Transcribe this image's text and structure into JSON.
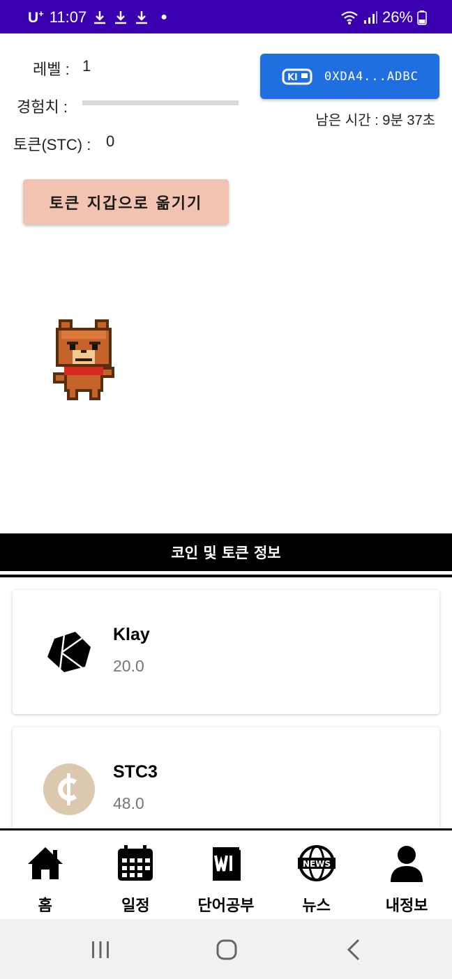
{
  "status_bar": {
    "carrier": "U",
    "carrier_sup": "+",
    "time": "11:07",
    "battery": "26%",
    "icons": [
      "download-icon",
      "download-icon",
      "download-icon",
      "dot-icon",
      "wifi-icon",
      "signal-icon",
      "battery-icon"
    ]
  },
  "profile": {
    "level_label": "레벨 :",
    "level_value": "1",
    "exp_label": "경험치 :",
    "exp_progress": 0,
    "token_label": "토큰(STC) :",
    "token_value": "0"
  },
  "wallet": {
    "logo_text": "Kl",
    "address": "0XDA4...ADBC",
    "time_left": "남은 시간 : 9분 37초"
  },
  "actions": {
    "move_tokens": "토큰 지갑으로 옮기기"
  },
  "section": {
    "title": "코인 및 토큰 정보"
  },
  "coins": [
    {
      "name": "Klay",
      "amount": "20.0",
      "icon": "klay-logo-icon"
    },
    {
      "name": "STC3",
      "amount": "48.0",
      "icon": "cent-coin-icon"
    }
  ],
  "nav": {
    "items": [
      {
        "label": "홈",
        "icon": "home-icon"
      },
      {
        "label": "일정",
        "icon": "calendar-icon"
      },
      {
        "label": "단어공부",
        "icon": "word-book-icon"
      },
      {
        "label": "뉴스",
        "icon": "news-globe-icon",
        "badge_text": "NEWS"
      },
      {
        "label": "내정보",
        "icon": "user-icon"
      }
    ]
  },
  "colors": {
    "status_bar": "#3a00b0",
    "wallet_button": "#1f6fe0",
    "move_button": "#f2c3b0",
    "section_header": "#000000",
    "coin_amount": "#777777"
  }
}
